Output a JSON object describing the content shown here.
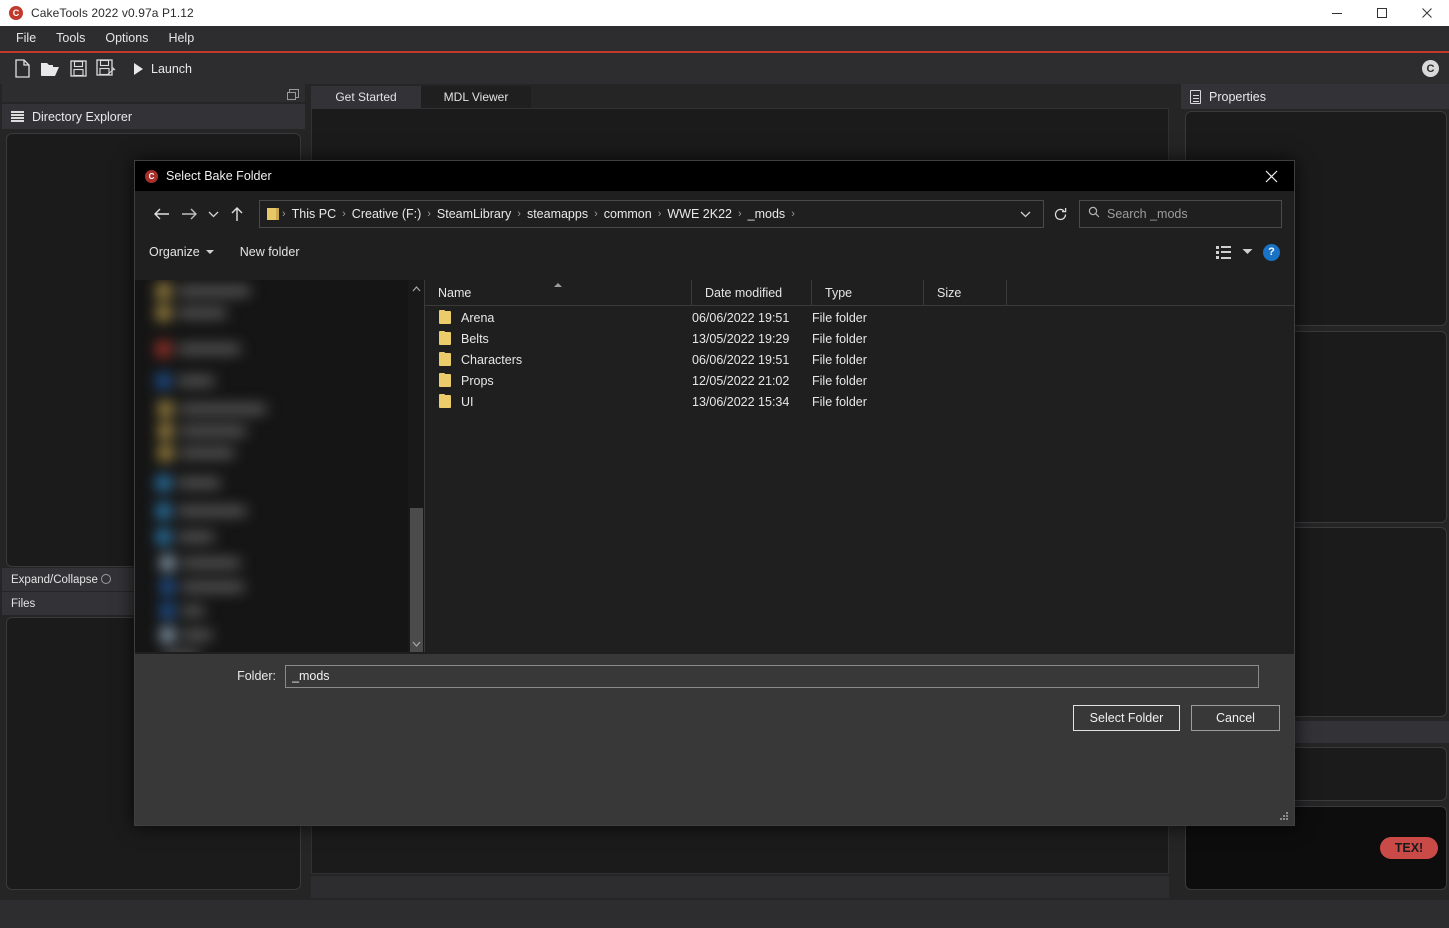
{
  "app": {
    "title": "CakeTools 2022 v0.97a P1.12",
    "icon": "app-logo-icon",
    "window_controls": {
      "minimize": "—",
      "maximize": "□",
      "close": "✕"
    },
    "menu": [
      "File",
      "Tools",
      "Options",
      "Help"
    ],
    "toolbar": {
      "icons": [
        "new-file-icon",
        "open-folder-icon",
        "save-icon",
        "save-as-icon"
      ],
      "launch_label": "Launch",
      "logo_letter": "C"
    },
    "accent_color": "#c0392b"
  },
  "left_panel": {
    "header": "Directory Explorer",
    "expand_collapse_label": "Expand/Collapse",
    "files_label": "Files"
  },
  "center": {
    "tabs": [
      {
        "label": "Get Started",
        "active": true
      },
      {
        "label": "MDL Viewer",
        "active": false
      }
    ]
  },
  "right_panel": {
    "header": "Properties"
  },
  "status": {
    "tex_badge": "TEX!"
  },
  "dialog": {
    "title": "Select Bake Folder",
    "close_label": "✕",
    "nav": {
      "back": "←",
      "forward": "→",
      "recent": "⌄",
      "up": "↑",
      "dropdown": "⌄",
      "refresh": "↻"
    },
    "breadcrumbs": [
      "This PC",
      "Creative (F:)",
      "SteamLibrary",
      "steamapps",
      "common",
      "WWE 2K22",
      "_mods"
    ],
    "breadcrumb_separator": "›",
    "search": {
      "placeholder": "Search _mods",
      "value": "",
      "icon": "search-icon"
    },
    "commands": {
      "organize": "Organize",
      "new_folder": "New folder",
      "view_icon": "view-layout-icon",
      "view_caret": "▾",
      "help": "?"
    },
    "columns": [
      {
        "key": "name",
        "label": "Name",
        "sorted": true
      },
      {
        "key": "date",
        "label": "Date modified"
      },
      {
        "key": "type",
        "label": "Type"
      },
      {
        "key": "size",
        "label": "Size"
      }
    ],
    "rows": [
      {
        "name": "Arena",
        "date": "06/06/2022 19:51",
        "type": "File folder",
        "size": ""
      },
      {
        "name": "Belts",
        "date": "13/05/2022 19:29",
        "type": "File folder",
        "size": ""
      },
      {
        "name": "Characters",
        "date": "06/06/2022 19:51",
        "type": "File folder",
        "size": ""
      },
      {
        "name": "Props",
        "date": "12/05/2022 21:02",
        "type": "File folder",
        "size": ""
      },
      {
        "name": "UI",
        "date": "13/06/2022 15:34",
        "type": "File folder",
        "size": ""
      }
    ],
    "footer": {
      "folder_label": "Folder:",
      "folder_value": "_mods",
      "select_button": "Select Folder",
      "cancel_button": "Cancel"
    },
    "scroll": {
      "up": "⌃",
      "down": "⌄"
    }
  }
}
